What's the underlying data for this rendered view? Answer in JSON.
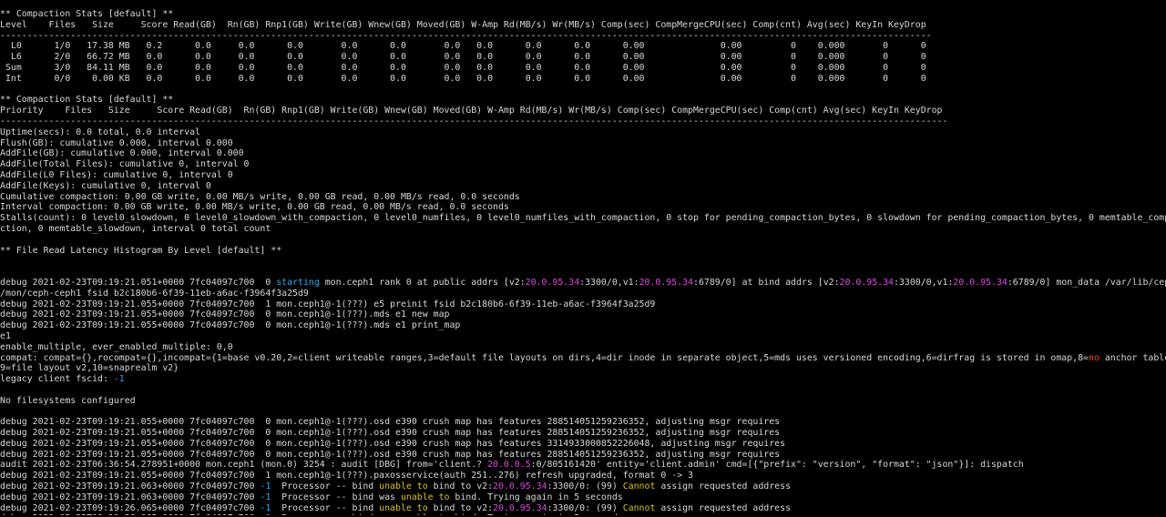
{
  "colors": {
    "background": "#000000",
    "text": "#d7d7d7",
    "cyan": "#3aa6dd",
    "magenta": "#d84ad8",
    "red": "#e0453a",
    "yellow": "#d8c020"
  },
  "terminal": {
    "lines": [
      [
        {
          "t": "** Compaction Stats [default] **"
        }
      ],
      [
        {
          "t": "Level    Files   Size     Score Read(GB)  Rn(GB) Rnp1(GB) Write(GB) Wnew(GB) Moved(GB) W-Amp Rd(MB/s) Wr(MB/s) Comp(sec) CompMergeCPU(sec) Comp(cnt) Avg(sec) KeyIn KeyDrop"
        }
      ],
      [
        {
          "t": "----------------------------------------------------------------------------------------------------------------------------------------------------------------------------"
        }
      ],
      [
        {
          "t": "  L0      1/0   17.38 MB   0.2      0.0     0.0      0.0       0.0      0.0       0.0   0.0      0.0      0.0      0.00              0.00         0    0.000       0      0"
        }
      ],
      [
        {
          "t": "  L6      2/0   66.72 MB   0.0      0.0     0.0      0.0       0.0      0.0       0.0   0.0      0.0      0.0      0.00              0.00         0    0.000       0      0"
        }
      ],
      [
        {
          "t": " Sum      3/0   84.11 MB   0.0      0.0     0.0      0.0       0.0      0.0       0.0   0.0      0.0      0.0      0.00              0.00         0    0.000       0      0"
        }
      ],
      [
        {
          "t": " Int      0/0    0.00 KB   0.0      0.0     0.0      0.0       0.0      0.0       0.0   0.0      0.0      0.0      0.00              0.00         0    0.000       0      0"
        }
      ],
      [
        {
          "t": ""
        }
      ],
      [
        {
          "t": "** Compaction Stats [default] **"
        }
      ],
      [
        {
          "t": "Priority    Files   Size     Score Read(GB)  Rn(GB) Rnp1(GB) Write(GB) Wnew(GB) Moved(GB) W-Amp Rd(MB/s) Wr(MB/s) Comp(sec) CompMergeCPU(sec) Comp(cnt) Avg(sec) KeyIn KeyDrop"
        }
      ],
      [
        {
          "t": "-------------------------------------------------------------------------------------------------------------------------------------------------------------------------------"
        }
      ],
      [
        {
          "t": "Uptime(secs): 0.0 total, 0.0 interval"
        }
      ],
      [
        {
          "t": "Flush(GB): cumulative 0.000, interval 0.000"
        }
      ],
      [
        {
          "t": "AddFile(GB): cumulative 0.000, interval 0.000"
        }
      ],
      [
        {
          "t": "AddFile(Total Files): cumulative 0, interval 0"
        }
      ],
      [
        {
          "t": "AddFile(L0 Files): cumulative 0, interval 0"
        }
      ],
      [
        {
          "t": "AddFile(Keys): cumulative 0, interval 0"
        }
      ],
      [
        {
          "t": "Cumulative compaction: 0.00 GB write, 0.00 MB/s write, 0.00 GB read, 0.00 MB/s read, 0.0 seconds"
        }
      ],
      [
        {
          "t": "Interval compaction: 0.00 GB write, 0.00 MB/s write, 0.00 GB read, 0.00 MB/s read, 0.0 seconds"
        }
      ],
      [
        {
          "t": "Stalls(count): 0 level0_slowdown, 0 level0_slowdown_with_compaction, 0 level0_numfiles, 0 level0_numfiles_with_compaction, 0 stop for pending_compaction_bytes, 0 slowdown for pending_compaction_bytes, 0 memtable_compa"
        }
      ],
      [
        {
          "t": "ction, 0 memtable_slowdown, interval 0 total count"
        }
      ],
      [
        {
          "t": ""
        }
      ],
      [
        {
          "t": "** File Read Latency Histogram By Level [default] **"
        }
      ],
      [
        {
          "t": ""
        }
      ],
      [
        {
          "t": ""
        }
      ],
      [
        {
          "t": "debug 2021-02-23T09:19:21.051+0000 7fc04097c700  0 "
        },
        {
          "t": "starting",
          "c": "cyan"
        },
        {
          "t": " mon.ceph1 rank 0 at public addrs [v2:"
        },
        {
          "t": "20.0.95.34",
          "c": "magenta"
        },
        {
          "t": ":3300/0,v1:"
        },
        {
          "t": "20.0.95.34",
          "c": "magenta"
        },
        {
          "t": ":6789/0] at bind addrs [v2:"
        },
        {
          "t": "20.0.95.34",
          "c": "magenta"
        },
        {
          "t": ":3300/0,v1:"
        },
        {
          "t": "20.0.95.34",
          "c": "magenta"
        },
        {
          "t": ":6789/0] mon_data /var/lib/ceph"
        }
      ],
      [
        {
          "t": "/mon/ceph-ceph1 fsid b2c180b6-6f39-11eb-a6ac-f3964f3a25d9"
        }
      ],
      [
        {
          "t": "debug 2021-02-23T09:19:21.055+0000 7fc04097c700  1 mon.ceph1@-1(???) e5 preinit fsid b2c180b6-6f39-11eb-a6ac-f3964f3a25d9"
        }
      ],
      [
        {
          "t": "debug 2021-02-23T09:19:21.055+0000 7fc04097c700  0 mon.ceph1@-1(???).mds e1 new map"
        }
      ],
      [
        {
          "t": "debug 2021-02-23T09:19:21.055+0000 7fc04097c700  0 mon.ceph1@-1(???).mds e1 print_map"
        }
      ],
      [
        {
          "t": "e1"
        }
      ],
      [
        {
          "t": "enable_multiple, ever_enabled_multiple: 0,0"
        }
      ],
      [
        {
          "t": "compat: compat={},rocompat={},incompat={1=base v0.20,2=client writeable ranges,3=default file layouts on dirs,4=dir inode in separate object,5=mds uses versioned encoding,6=dirfrag is stored in omap,8="
        },
        {
          "t": "no",
          "c": "red"
        },
        {
          "t": " anchor table"
        }
      ],
      [
        {
          "t": "9=file layout v2,10=snaprealm v2}"
        }
      ],
      [
        {
          "t": "legacy client fscid: "
        },
        {
          "t": "-1",
          "c": "cyan"
        }
      ],
      [
        {
          "t": ""
        }
      ],
      [
        {
          "t": "No filesystems configured"
        }
      ],
      [
        {
          "t": ""
        }
      ],
      [
        {
          "t": "debug 2021-02-23T09:19:21.055+0000 7fc04097c700  0 mon.ceph1@-1(???).osd e390 crush map has features 288514051259236352, adjusting msgr requires"
        }
      ],
      [
        {
          "t": "debug 2021-02-23T09:19:21.055+0000 7fc04097c700  0 mon.ceph1@-1(???).osd e390 crush map has features 288514051259236352, adjusting msgr requires"
        }
      ],
      [
        {
          "t": "debug 2021-02-23T09:19:21.055+0000 7fc04097c700  0 mon.ceph1@-1(???).osd e390 crush map has features 3314933000852226048, adjusting msgr requires"
        }
      ],
      [
        {
          "t": "debug 2021-02-23T09:19:21.055+0000 7fc04097c700  0 mon.ceph1@-1(???).osd e390 crush map has features 288514051259236352, adjusting msgr requires"
        }
      ],
      [
        {
          "t": "audit 2021-02-23T06:36:54.278951+0000 mon.ceph1 (mon.0) 3254 : audit [DBG] from='client.? "
        },
        {
          "t": "20.0.0.5",
          "c": "magenta"
        },
        {
          "t": ":0/805161420' entity='client.admin' cmd=[{\"prefix\": \"version\", \"format\": \"json\"}]: dispatch"
        }
      ],
      [
        {
          "t": "debug 2021-02-23T09:19:21.055+0000 7fc04097c700  1 mon.ceph1@-1(???).paxosservice(auth 251..276) refresh upgraded, format 0 -> 3"
        }
      ],
      [
        {
          "t": "debug 2021-02-23T09:19:21.063+0000 7fc04097c700 "
        },
        {
          "t": "-1",
          "c": "cyan"
        },
        {
          "t": "  Processor -- bind "
        },
        {
          "t": "unable to",
          "c": "yellow"
        },
        {
          "t": " bind to v2:"
        },
        {
          "t": "20.0.95.34",
          "c": "magenta"
        },
        {
          "t": ":3300/0: (99) "
        },
        {
          "t": "Cannot",
          "c": "yellow"
        },
        {
          "t": " assign requested address"
        }
      ],
      [
        {
          "t": "debug 2021-02-23T09:19:21.063+0000 7fc04097c700 "
        },
        {
          "t": "-1",
          "c": "cyan"
        },
        {
          "t": "  Processor -- bind was "
        },
        {
          "t": "unable to",
          "c": "yellow"
        },
        {
          "t": " bind. Trying again in 5 seconds"
        }
      ],
      [
        {
          "t": "debug 2021-02-23T09:19:26.065+0000 7fc04097c700 "
        },
        {
          "t": "-1",
          "c": "cyan"
        },
        {
          "t": "  Processor -- bind "
        },
        {
          "t": "unable to",
          "c": "yellow"
        },
        {
          "t": " bind to v2:"
        },
        {
          "t": "20.0.95.34",
          "c": "magenta"
        },
        {
          "t": ":3300/0: (99) "
        },
        {
          "t": "Cannot",
          "c": "yellow"
        },
        {
          "t": " assign requested address"
        }
      ],
      [
        {
          "t": "debug 2021-02-23T09:19:26.065+0000 7fc04097c700 "
        },
        {
          "t": "-1",
          "c": "cyan"
        },
        {
          "t": "  Processor -- bind was "
        },
        {
          "t": "unable to",
          "c": "yellow"
        },
        {
          "t": " bind. Trying again in 5 seconds"
        }
      ]
    ]
  }
}
